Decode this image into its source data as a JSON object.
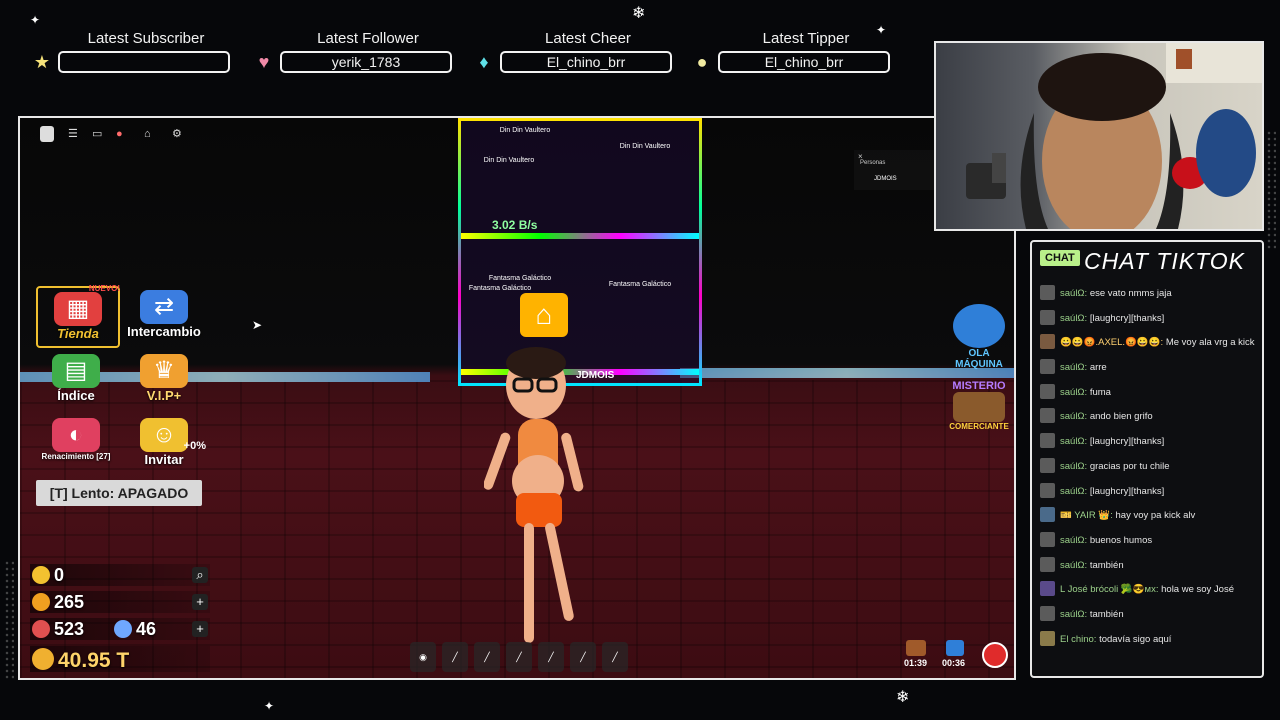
{
  "alerts": [
    {
      "title": "Latest Subscriber",
      "value": "",
      "icon": "star-icon",
      "color": "#f5e27a"
    },
    {
      "title": "Latest Follower",
      "value": "yerik_1783",
      "icon": "heart-icon",
      "color": "#f08aa8"
    },
    {
      "title": "Latest Cheer",
      "value": "El_chino_brr",
      "icon": "diamond-icon",
      "color": "#5fe0e8"
    },
    {
      "title": "Latest Tipper",
      "value": "El_chino_brr",
      "icon": "coin-icon",
      "color": "#f0eaa0"
    }
  ],
  "game": {
    "menu": [
      {
        "label": "Tienda",
        "icon": "shop-basket-icon",
        "badge": "NUEVO!",
        "color": "#e2403f"
      },
      {
        "label": "Intercambio",
        "icon": "trade-arrows-icon",
        "badge": "",
        "color": "#3b7de0"
      },
      {
        "label": "Índice",
        "icon": "book-icon",
        "badge": "",
        "color": "#3fae4a"
      },
      {
        "label": "V.I.P+",
        "icon": "crown-icon",
        "badge": "",
        "color": "#f0a030"
      },
      {
        "label": "Renacimiento [27]",
        "icon": "rebirth-icon",
        "badge": "",
        "color": "#e04060"
      },
      {
        "label": "Invitar",
        "icon": "friends-icon",
        "badge": "+0%",
        "color": "#f0c030"
      }
    ],
    "lento": "[T] Lento: APAGADO",
    "stats": [
      {
        "value": "0",
        "icon": "coin-icon",
        "color": "#f2c230",
        "action": "search"
      },
      {
        "value": "265",
        "icon": "gem-icon",
        "color": "#f0a020",
        "action": "plus"
      },
      {
        "value": "523",
        "icon": "sneaker-icon",
        "color": "#e05050",
        "action": ""
      },
      {
        "value": "40.95 T",
        "icon": "money-bag-icon",
        "color": "#f0b030",
        "action": ""
      }
    ],
    "stat_extra": {
      "value": "46",
      "icon": "speed-shoe-icon"
    },
    "tower": {
      "labels": [
        "Din Din Vaultero",
        "Din Din Vaultero",
        "Din Din Vaultero",
        "Fantasma Galáctico",
        "Fantasma Galáctico",
        "Fantasma Galáctico"
      ],
      "rate": "3.02 B/s",
      "player": "JDMOIS"
    },
    "events": [
      {
        "label": "OLA MÁQUINA",
        "icon": "wave-machine-icon",
        "color": "#5fc6ff"
      },
      {
        "label": "MISTERIO",
        "icon": "mystery-icon",
        "color": "#b57cff"
      },
      {
        "label": "COMERCIANTE",
        "icon": "merchant-cart-icon",
        "color": "#ffd23d"
      }
    ],
    "timers": [
      "01:39",
      "00:36"
    ],
    "players_panel": {
      "title": "Personas",
      "name": "JDMOIS"
    }
  },
  "chat": {
    "badge": "CHAT",
    "title": "CHAT TIKTOK",
    "messages": [
      {
        "user": "saúlΩ:",
        "text": "ese vato nmms jaja"
      },
      {
        "user": "saúlΩ:",
        "text": "[laughcry][thanks]"
      },
      {
        "user": "😀😀😡.AXEL.😡😀😀:",
        "text": "Me voy ala vrg a kick"
      },
      {
        "user": "saúlΩ:",
        "text": "arre"
      },
      {
        "user": "saúlΩ:",
        "text": "fuma"
      },
      {
        "user": "saúlΩ:",
        "text": "ando bien grifo"
      },
      {
        "user": "saúlΩ:",
        "text": "[laughcry][thanks]"
      },
      {
        "user": "saúlΩ:",
        "text": "gracias por tu chile"
      },
      {
        "user": "saúlΩ:",
        "text": "[laughcry][thanks]"
      },
      {
        "user": "🎫 YAIR 👑:",
        "text": "hay voy pa kick alv"
      },
      {
        "user": "saúlΩ:",
        "text": "buenos humos"
      },
      {
        "user": "saúlΩ:",
        "text": "también"
      },
      {
        "user": "L José brócoli 🥦😎мх:",
        "text": "hola we soy José"
      },
      {
        "user": "saúlΩ:",
        "text": "también"
      },
      {
        "user": "El chino:",
        "text": "todavía sigo aquí"
      }
    ]
  }
}
